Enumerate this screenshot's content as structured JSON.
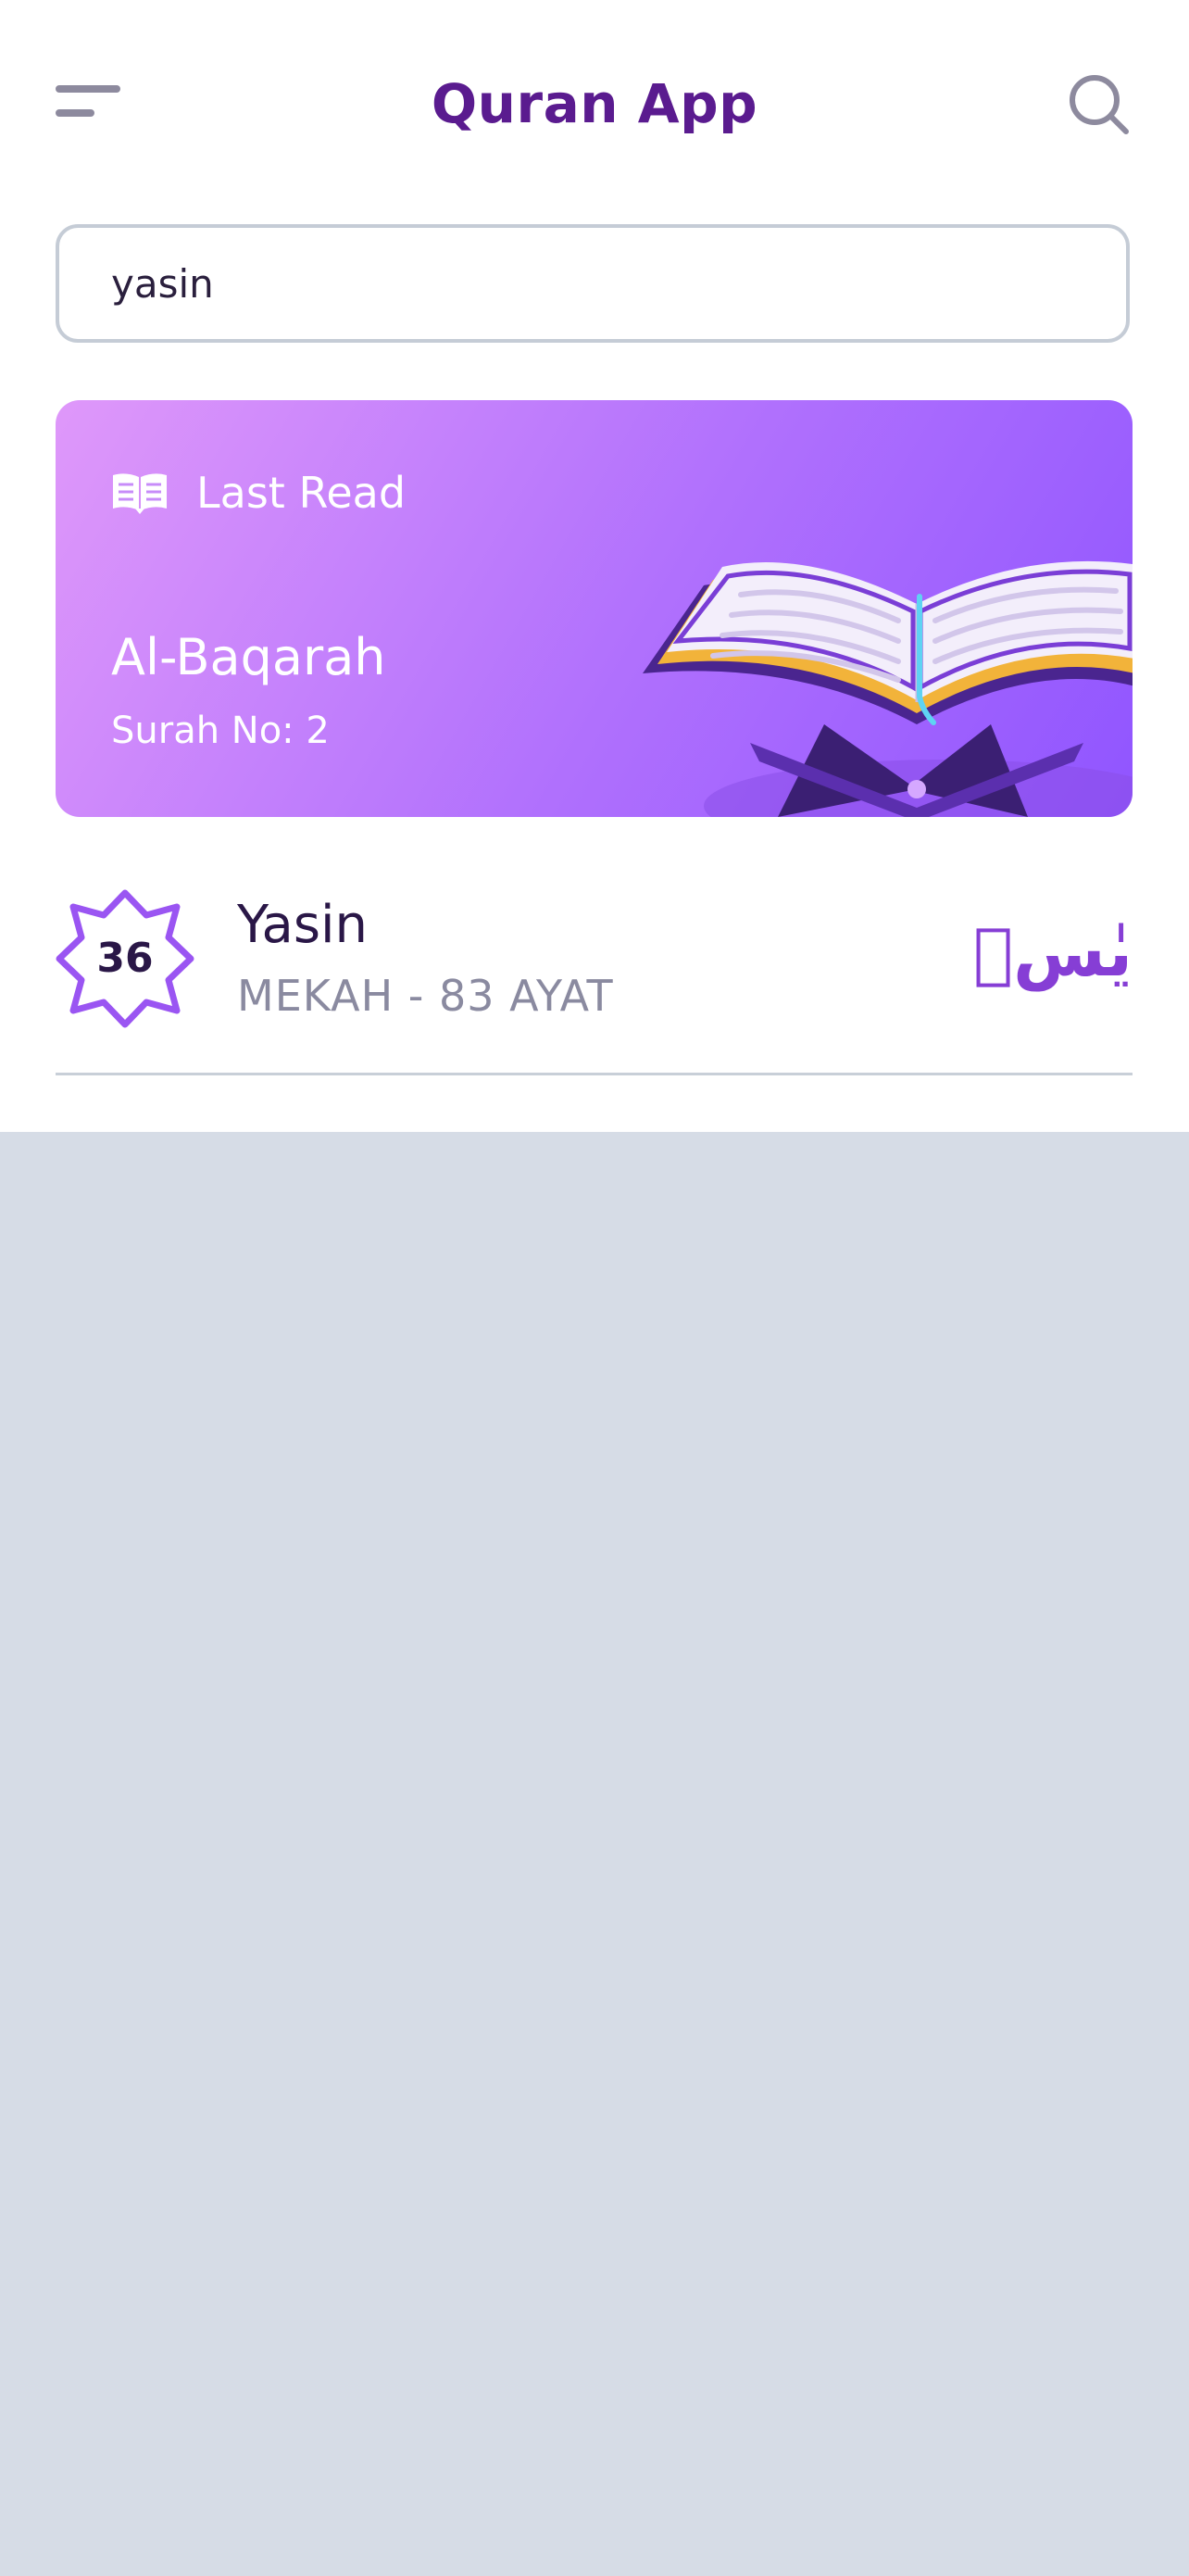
{
  "header": {
    "title": "Quran App",
    "menu_icon": "menu-icon",
    "search_icon": "search-icon"
  },
  "search": {
    "value": "yasin"
  },
  "last_read": {
    "label": "Last Read",
    "icon": "book-icon",
    "surah_name": "Al-Baqarah",
    "surah_number": "Surah No: 2"
  },
  "results": [
    {
      "number": "36",
      "name": "Yasin",
      "meta": "MEKAH - 83 AYAT",
      "arabic": "يٰسۤ"
    }
  ],
  "colors": {
    "brand": "#5a1b8f",
    "accent": "#9055ff",
    "card_gradient_start": "#df98fa",
    "card_gradient_end": "#9055ff",
    "background": "#d6dce6"
  }
}
